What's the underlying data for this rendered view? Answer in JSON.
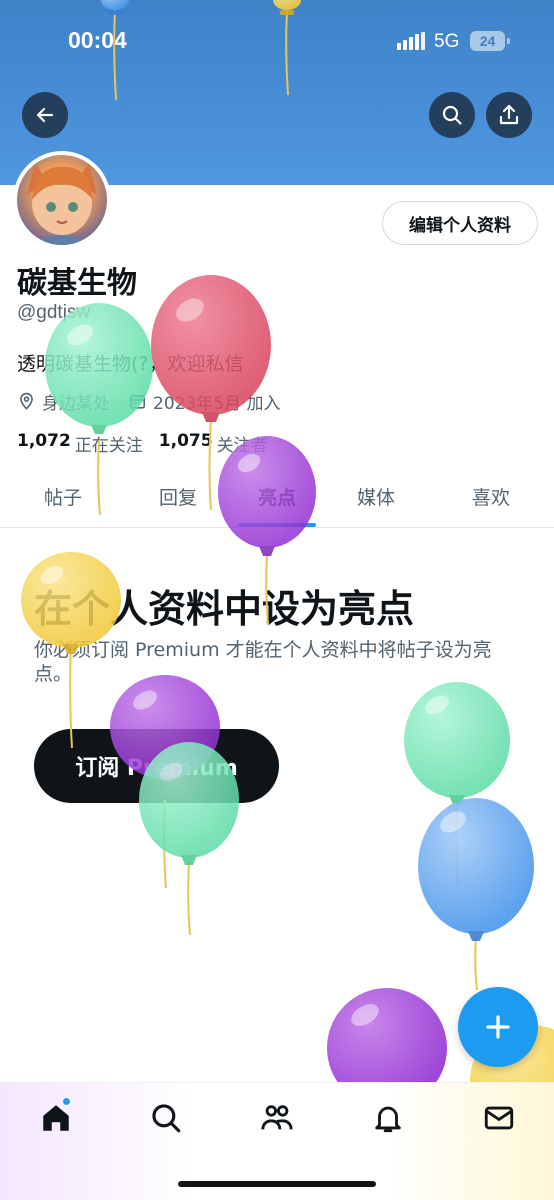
{
  "status_bar": {
    "time": "00:04",
    "network": "5G",
    "battery": "24"
  },
  "header": {
    "back_icon": "arrow-left-icon",
    "search_icon": "search-icon",
    "share_icon": "share-upload-icon"
  },
  "profile": {
    "edit_label": "编辑个人资料",
    "display_name": "碳基生物",
    "handle": "@gdtjsw",
    "bio": "透明碳基生物(?，欢迎私信",
    "location": "身边某处",
    "joined": "2023年5月 加入",
    "following_count": "1,072",
    "following_label": "正在关注",
    "followers_count": "1,075",
    "followers_label": "关注者"
  },
  "tabs": [
    {
      "label": "帖子"
    },
    {
      "label": "回复"
    },
    {
      "label": "亮点",
      "active": true
    },
    {
      "label": "媒体"
    },
    {
      "label": "喜欢"
    }
  ],
  "highlights": {
    "title": "在个人资料中设为亮点",
    "description": "你必须订阅 Premium 才能在个人资料中将帖子设为亮点。",
    "button_label": "订阅 Premium"
  },
  "fab": {
    "icon": "plus-icon"
  },
  "bottom_nav": {
    "items": [
      {
        "icon": "home-icon",
        "has_badge": true
      },
      {
        "icon": "search-icon"
      },
      {
        "icon": "communities-icon"
      },
      {
        "icon": "bell-icon"
      },
      {
        "icon": "mail-icon"
      }
    ]
  },
  "colors": {
    "accent": "#1d9bf0",
    "banner": "#4f97e0",
    "text_primary": "#0f1419",
    "text_secondary": "#536471"
  }
}
